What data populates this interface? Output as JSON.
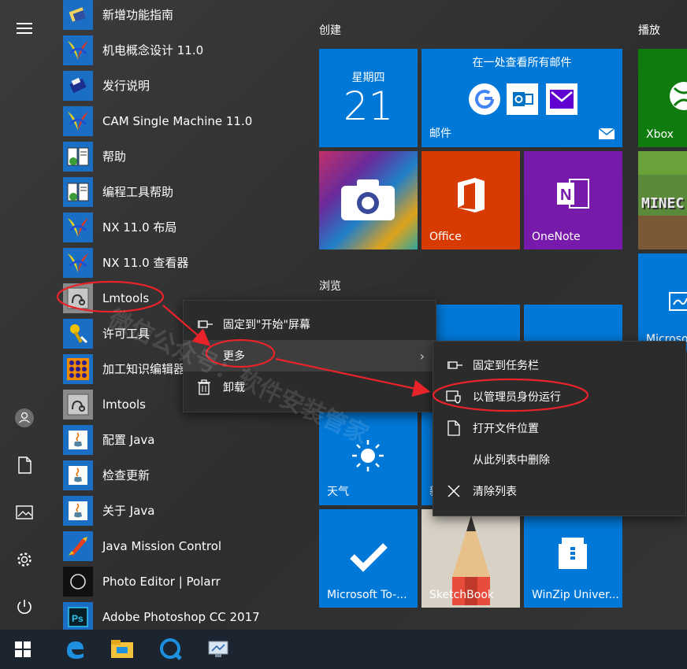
{
  "rail": {
    "icons": [
      "hamburger-icon",
      "user-icon",
      "document-icon",
      "pictures-icon",
      "settings-icon",
      "power-icon"
    ]
  },
  "apps": [
    {
      "label": "新增功能指南",
      "icon": "nx-book-icon"
    },
    {
      "label": "机电概念设计 11.0",
      "icon": "nx-logo-icon"
    },
    {
      "label": "发行说明",
      "icon": "release-notes-icon"
    },
    {
      "label": "CAM Single Machine 11.0",
      "icon": "nx-logo-icon"
    },
    {
      "label": "帮助",
      "icon": "help-book-icon"
    },
    {
      "label": "编程工具帮助",
      "icon": "help-book-icon"
    },
    {
      "label": "NX 11.0 布局",
      "icon": "nx-logo-icon"
    },
    {
      "label": "NX 11.0 查看器",
      "icon": "nx-logo-icon"
    },
    {
      "label": "Lmtools",
      "icon": "lmtools-icon"
    },
    {
      "label": "许可工具",
      "icon": "license-tool-icon"
    },
    {
      "label": "加工知识编辑器",
      "icon": "knowledge-editor-icon"
    },
    {
      "label": "lmtools",
      "icon": "lmtools-icon"
    },
    {
      "label": "配置 Java",
      "icon": "java-icon"
    },
    {
      "label": "检查更新",
      "icon": "java-icon"
    },
    {
      "label": "关于 Java",
      "icon": "java-icon"
    },
    {
      "label": "Java Mission Control",
      "icon": "mission-control-icon"
    },
    {
      "label": "Photo Editor | Polarr",
      "icon": "polarr-icon"
    },
    {
      "label": "Adobe Photoshop CC 2017",
      "icon": "photoshop-icon"
    }
  ],
  "groups": {
    "create": "创建",
    "play": "播放",
    "browse": "浏览"
  },
  "tiles": {
    "calendar": {
      "weekday": "星期四",
      "day": "21"
    },
    "mail": {
      "header": "在一处查看所有邮件",
      "label": "邮件"
    },
    "xbox": {
      "label": "Xbox"
    },
    "office": {
      "label": "Office"
    },
    "onenote": {
      "label": "OneNote"
    },
    "minecraft": {
      "text": "MINEC"
    },
    "partial": {
      "label": "Microso"
    },
    "weather": {
      "label": "天气"
    },
    "weather_next": {
      "label": "新"
    },
    "todo": {
      "label": "Microsoft To-..."
    },
    "sketchbook": {
      "label": "SketchBook"
    },
    "winzip": {
      "label": "WinZip Univer..."
    }
  },
  "context_menu": {
    "items": [
      "固定到\"开始\"屏幕",
      "更多",
      "卸载"
    ]
  },
  "submenu": {
    "items": [
      "固定到任务栏",
      "以管理员身份运行",
      "打开文件位置",
      "从此列表中删除",
      "清除列表"
    ]
  },
  "watermark": "微信公众号：软件安装管家",
  "taskbar": {
    "icons": [
      "windows-start-icon",
      "edge-icon",
      "file-explorer-icon",
      "quicktime-icon",
      "network-app-icon"
    ]
  },
  "colors": {
    "accent": "#0078d7",
    "annotation": "#e8232a",
    "office": "#d83b01",
    "onenote": "#7719aa",
    "xbox": "#107c10"
  }
}
